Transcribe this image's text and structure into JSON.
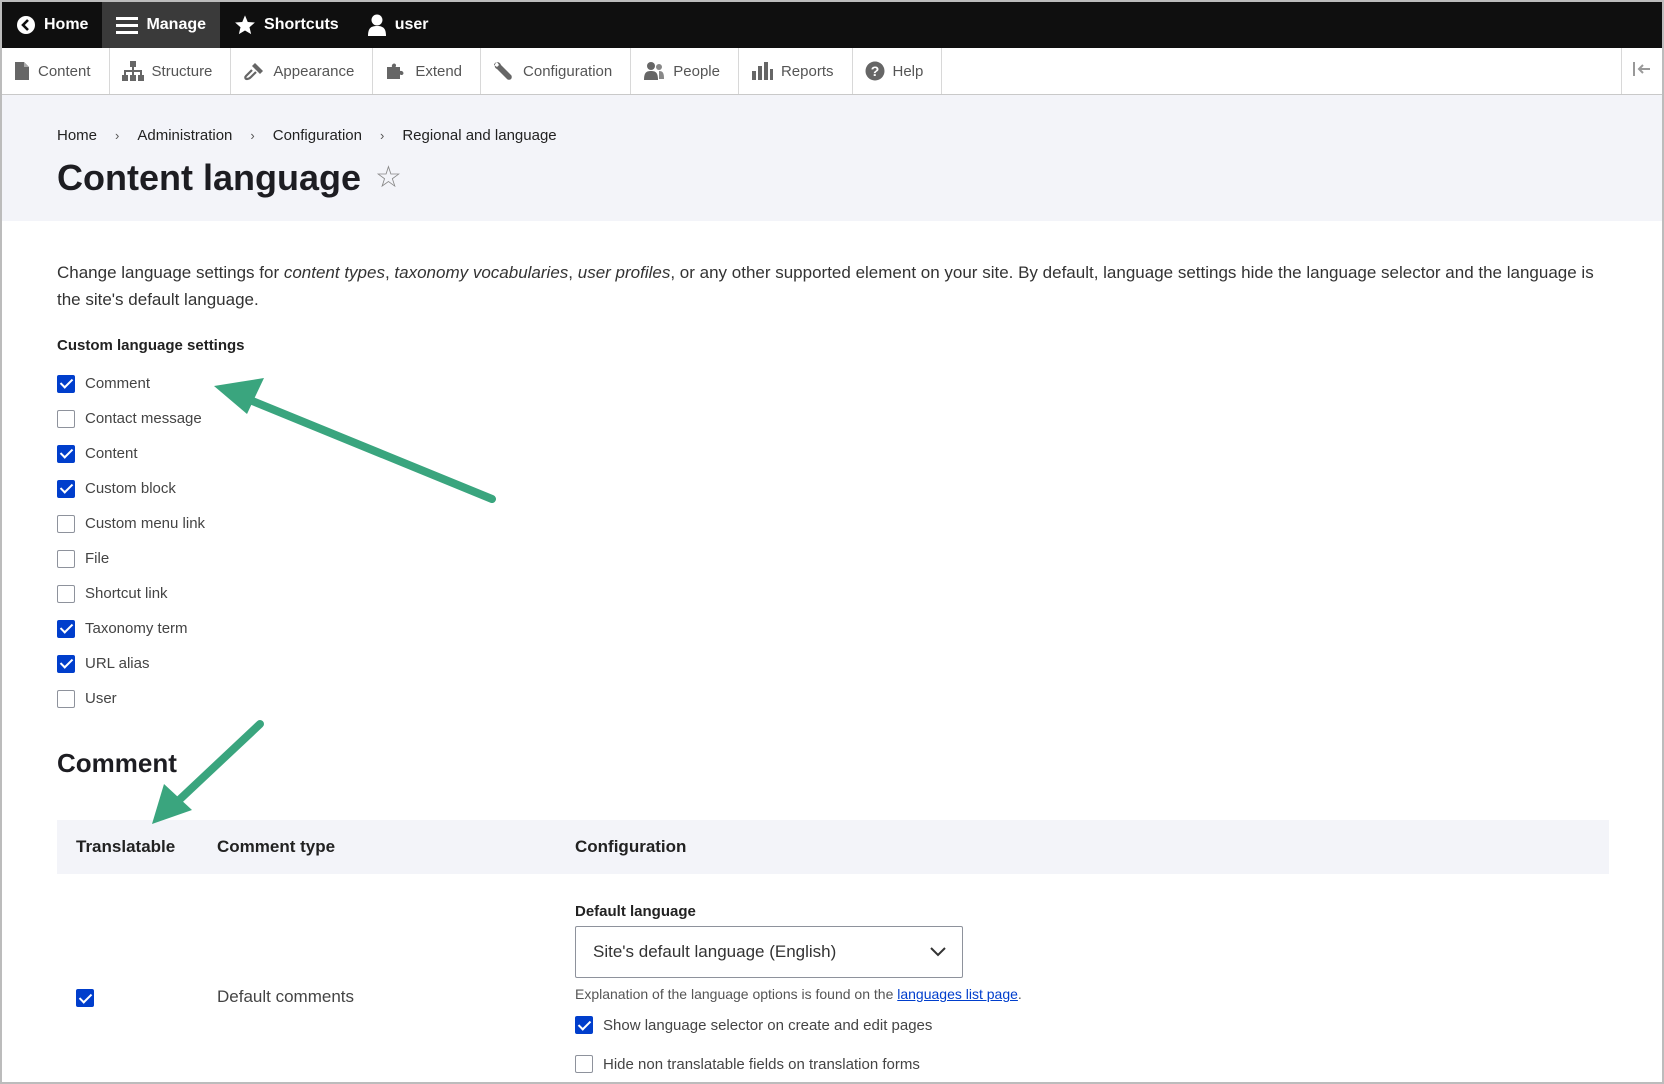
{
  "toolbar": {
    "items": [
      {
        "label": "Home",
        "icon": "home-back-icon"
      },
      {
        "label": "Manage",
        "icon": "menu-icon"
      },
      {
        "label": "Shortcuts",
        "icon": "star-icon"
      },
      {
        "label": "user",
        "icon": "user-icon"
      }
    ]
  },
  "tray": {
    "items": [
      {
        "label": "Content",
        "icon": "file-icon"
      },
      {
        "label": "Structure",
        "icon": "sitemap-icon"
      },
      {
        "label": "Appearance",
        "icon": "paintbrush-icon"
      },
      {
        "label": "Extend",
        "icon": "puzzle-icon"
      },
      {
        "label": "Configuration",
        "icon": "wrench-icon"
      },
      {
        "label": "People",
        "icon": "people-icon"
      },
      {
        "label": "Reports",
        "icon": "bar-chart-icon"
      },
      {
        "label": "Help",
        "icon": "help-icon"
      }
    ]
  },
  "breadcrumb": [
    "Home",
    "Administration",
    "Configuration",
    "Regional and language"
  ],
  "page": {
    "title": "Content language",
    "intro_parts": [
      "Change language settings for ",
      "content types",
      ", ",
      "taxonomy vocabularies",
      ", ",
      "user profiles",
      ", or any other supported element on your site. By default, language settings hide the language selector and the language is the site's default language."
    ]
  },
  "custom_settings": {
    "label": "Custom language settings",
    "items": [
      {
        "label": "Comment",
        "checked": true
      },
      {
        "label": "Contact message",
        "checked": false
      },
      {
        "label": "Content",
        "checked": true
      },
      {
        "label": "Custom block",
        "checked": true
      },
      {
        "label": "Custom menu link",
        "checked": false
      },
      {
        "label": "File",
        "checked": false
      },
      {
        "label": "Shortcut link",
        "checked": false
      },
      {
        "label": "Taxonomy term",
        "checked": true
      },
      {
        "label": "URL alias",
        "checked": true
      },
      {
        "label": "User",
        "checked": false
      }
    ]
  },
  "comment_section": {
    "heading": "Comment",
    "columns": [
      "Translatable",
      "Comment type",
      "Configuration"
    ],
    "row": {
      "translatable": true,
      "type": "Default comments",
      "default_language_label": "Default language",
      "default_language_value": "Site's default language (English)",
      "explanation_prefix": "Explanation of the language options is found on the ",
      "explanation_link": "languages list page",
      "explanation_suffix": ".",
      "show_selector_label": "Show language selector on create and edit pages",
      "show_selector_checked": true,
      "hide_fields_label": "Hide non translatable fields on translation forms",
      "hide_fields_checked": false
    }
  },
  "colors": {
    "accent": "#003ecc",
    "annotation_arrow": "#3aa57e",
    "toolbar_bg": "#0f0f0f",
    "header_bg": "#f3f4f9"
  }
}
